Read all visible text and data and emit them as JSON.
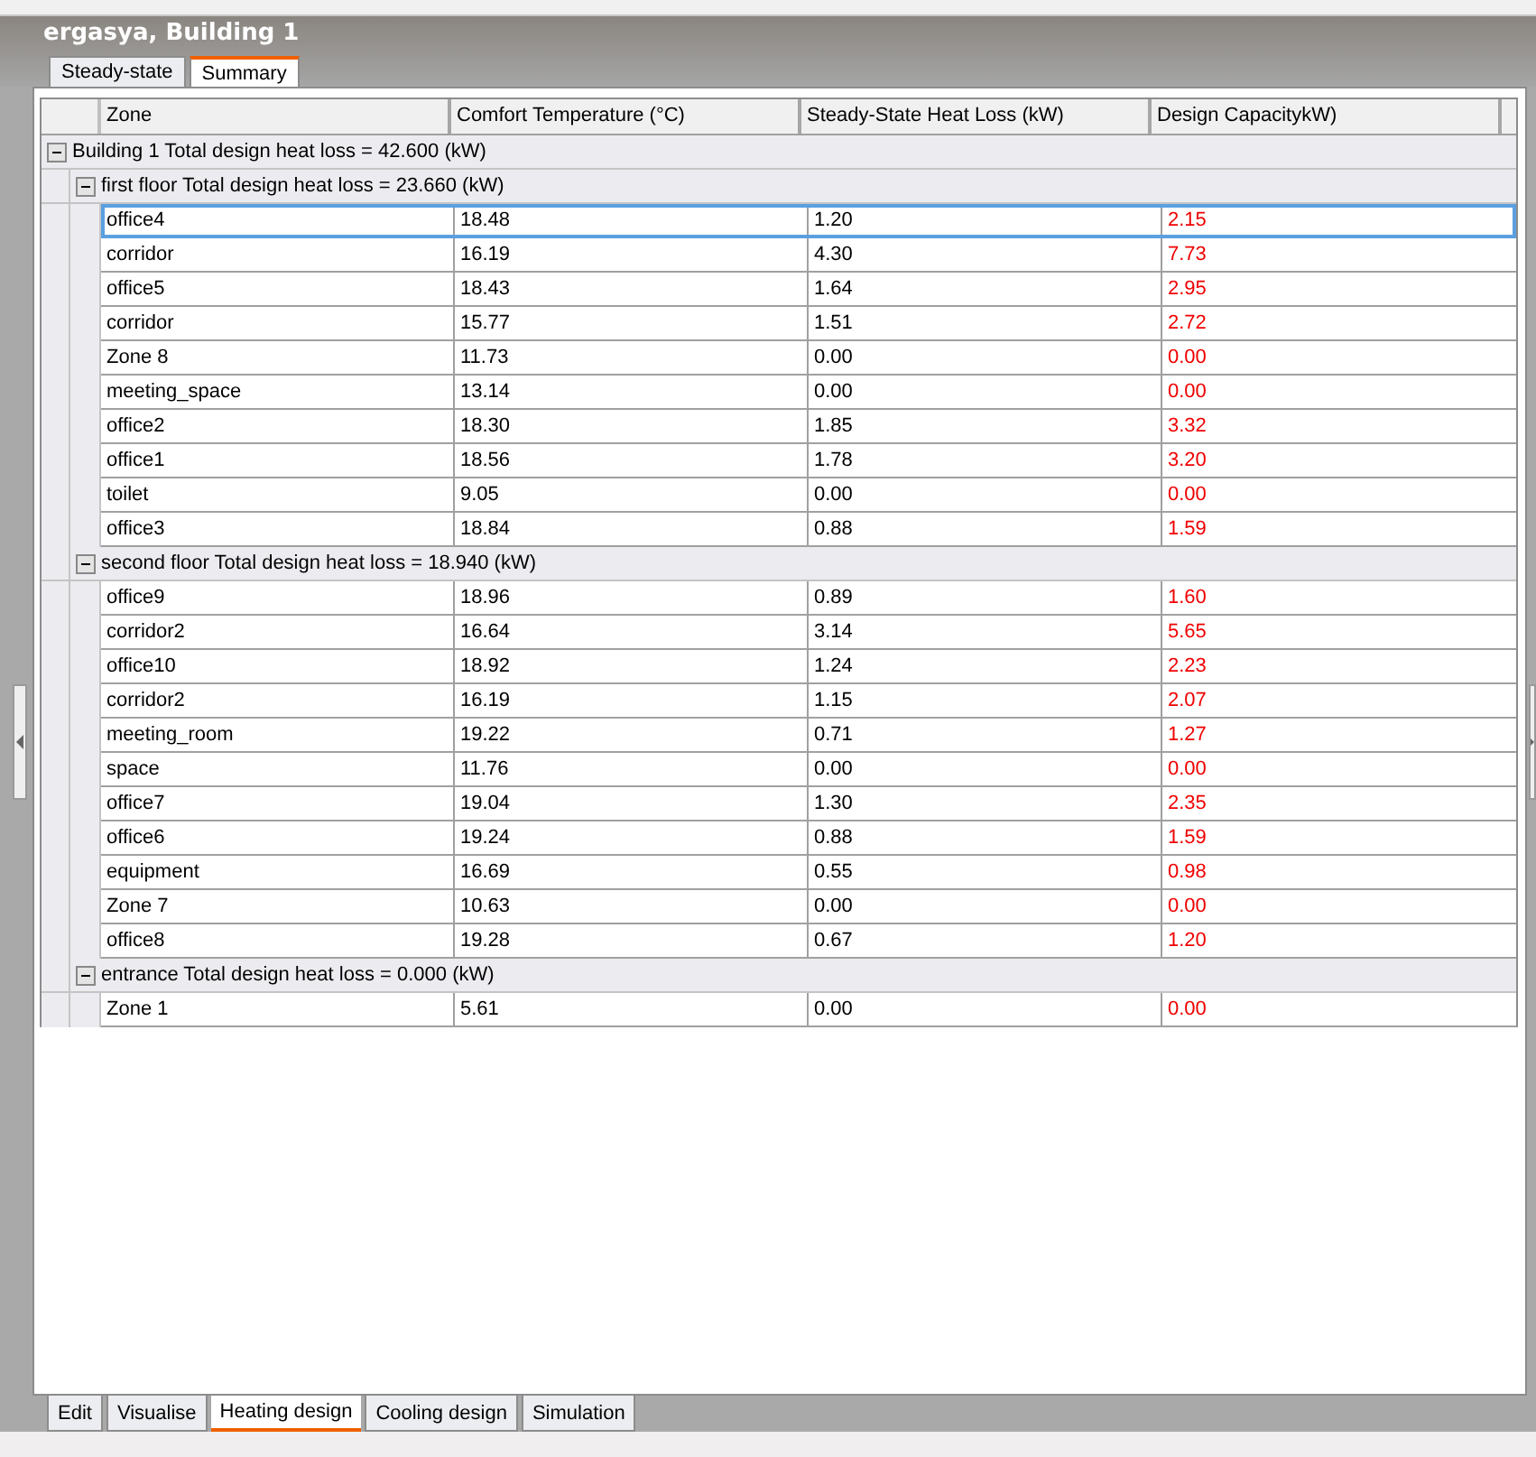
{
  "window": {
    "title": "ergasya, Building 1"
  },
  "view_tabs": [
    {
      "label": "Steady-state",
      "selected": false
    },
    {
      "label": "Summary",
      "selected": true
    }
  ],
  "table": {
    "columns": [
      "Zone",
      "Comfort Temperature (°C)",
      "Steady-State Heat Loss (kW)",
      "Design CapacitykW)"
    ],
    "groups": [
      {
        "label": "Building 1 Total design heat loss = 42.600 (kW)",
        "expanded": true,
        "children": [
          {
            "label": "first floor Total design heat loss = 23.660 (kW)",
            "expanded": true,
            "rows": [
              {
                "zone": "office4",
                "comfort": "18.48",
                "loss": "1.20",
                "capacity": "2.15",
                "selected": true
              },
              {
                "zone": "corridor",
                "comfort": "16.19",
                "loss": "4.30",
                "capacity": "7.73",
                "selected": false
              },
              {
                "zone": "office5",
                "comfort": "18.43",
                "loss": "1.64",
                "capacity": "2.95",
                "selected": false
              },
              {
                "zone": "corridor",
                "comfort": "15.77",
                "loss": "1.51",
                "capacity": "2.72",
                "selected": false
              },
              {
                "zone": "Zone 8",
                "comfort": "11.73",
                "loss": "0.00",
                "capacity": "0.00",
                "selected": false
              },
              {
                "zone": "meeting_space",
                "comfort": "13.14",
                "loss": "0.00",
                "capacity": "0.00",
                "selected": false
              },
              {
                "zone": "office2",
                "comfort": "18.30",
                "loss": "1.85",
                "capacity": "3.32",
                "selected": false
              },
              {
                "zone": "office1",
                "comfort": "18.56",
                "loss": "1.78",
                "capacity": "3.20",
                "selected": false
              },
              {
                "zone": "toilet",
                "comfort": "9.05",
                "loss": "0.00",
                "capacity": "0.00",
                "selected": false
              },
              {
                "zone": "office3",
                "comfort": "18.84",
                "loss": "0.88",
                "capacity": "1.59",
                "selected": false
              }
            ]
          },
          {
            "label": "second floor Total design heat loss = 18.940 (kW)",
            "expanded": true,
            "rows": [
              {
                "zone": "office9",
                "comfort": "18.96",
                "loss": "0.89",
                "capacity": "1.60",
                "selected": false
              },
              {
                "zone": "corridor2",
                "comfort": "16.64",
                "loss": "3.14",
                "capacity": "5.65",
                "selected": false
              },
              {
                "zone": "office10",
                "comfort": "18.92",
                "loss": "1.24",
                "capacity": "2.23",
                "selected": false
              },
              {
                "zone": "corridor2",
                "comfort": "16.19",
                "loss": "1.15",
                "capacity": "2.07",
                "selected": false
              },
              {
                "zone": "meeting_room",
                "comfort": "19.22",
                "loss": "0.71",
                "capacity": "1.27",
                "selected": false
              },
              {
                "zone": "space",
                "comfort": "11.76",
                "loss": "0.00",
                "capacity": "0.00",
                "selected": false
              },
              {
                "zone": "office7",
                "comfort": "19.04",
                "loss": "1.30",
                "capacity": "2.35",
                "selected": false
              },
              {
                "zone": "office6",
                "comfort": "19.24",
                "loss": "0.88",
                "capacity": "1.59",
                "selected": false
              },
              {
                "zone": "equipment",
                "comfort": "16.69",
                "loss": "0.55",
                "capacity": "0.98",
                "selected": false
              },
              {
                "zone": "Zone 7",
                "comfort": "10.63",
                "loss": "0.00",
                "capacity": "0.00",
                "selected": false
              },
              {
                "zone": "office8",
                "comfort": "19.28",
                "loss": "0.67",
                "capacity": "1.20",
                "selected": false
              }
            ]
          },
          {
            "label": "entrance Total design heat loss = 0.000 (kW)",
            "expanded": true,
            "rows": [
              {
                "zone": "Zone 1",
                "comfort": "5.61",
                "loss": "0.00",
                "capacity": "0.00",
                "selected": false
              }
            ]
          }
        ]
      }
    ]
  },
  "mode_tabs": [
    {
      "label": "Edit",
      "selected": false
    },
    {
      "label": "Visualise",
      "selected": false
    },
    {
      "label": "Heating design",
      "selected": true
    },
    {
      "label": "Cooling design",
      "selected": false
    },
    {
      "label": "Simulation",
      "selected": false
    }
  ]
}
